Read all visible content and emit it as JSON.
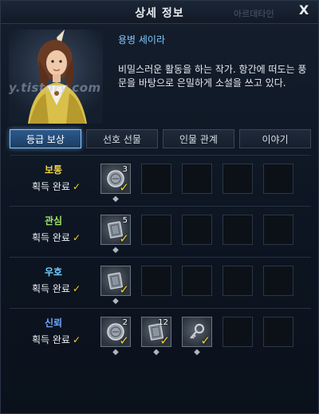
{
  "window": {
    "title": "상세 정보",
    "faded_title": "아르데타인",
    "close_label": "X"
  },
  "character": {
    "name": "용병 세이라",
    "description": "비밀스러운 활동을 하는 작가. 항간에 떠도는 풍문을 바탕으로 은밀하게 소설을 쓰고 있다.",
    "watermark": "y.tistory.com"
  },
  "tabs": [
    {
      "label": "등급 보상",
      "active": true
    },
    {
      "label": "선호 선물",
      "active": false
    },
    {
      "label": "인물 관계",
      "active": false
    },
    {
      "label": "이야기",
      "active": false
    }
  ],
  "grades": [
    {
      "name": "보통",
      "name_color": "#f0d24a",
      "status": "획득 완료",
      "slots": [
        {
          "filled": true,
          "count": "3",
          "icon": "coin-icon"
        },
        {
          "filled": false
        },
        {
          "filled": false
        },
        {
          "filled": false
        },
        {
          "filled": false
        }
      ]
    },
    {
      "name": "관심",
      "name_color": "#9be36a",
      "status": "획득 완료",
      "slots": [
        {
          "filled": true,
          "count": "5",
          "icon": "book-icon"
        },
        {
          "filled": false
        },
        {
          "filled": false
        },
        {
          "filled": false
        },
        {
          "filled": false
        }
      ]
    },
    {
      "name": "우호",
      "name_color": "#6fd1ff",
      "status": "획득 완료",
      "slots": [
        {
          "filled": true,
          "count": "",
          "icon": "book-icon"
        },
        {
          "filled": false
        },
        {
          "filled": false
        },
        {
          "filled": false
        },
        {
          "filled": false
        }
      ]
    },
    {
      "name": "신뢰",
      "name_color": "#6fa8ff",
      "status": "획득 완료",
      "slots": [
        {
          "filled": true,
          "count": "2",
          "icon": "coin-icon"
        },
        {
          "filled": true,
          "count": "12",
          "icon": "book-icon"
        },
        {
          "filled": true,
          "count": "",
          "icon": "key-icon"
        },
        {
          "filled": false
        },
        {
          "filled": false
        }
      ]
    }
  ],
  "colors": {
    "accent": "#7fc6ff",
    "check": "#f2d230"
  }
}
